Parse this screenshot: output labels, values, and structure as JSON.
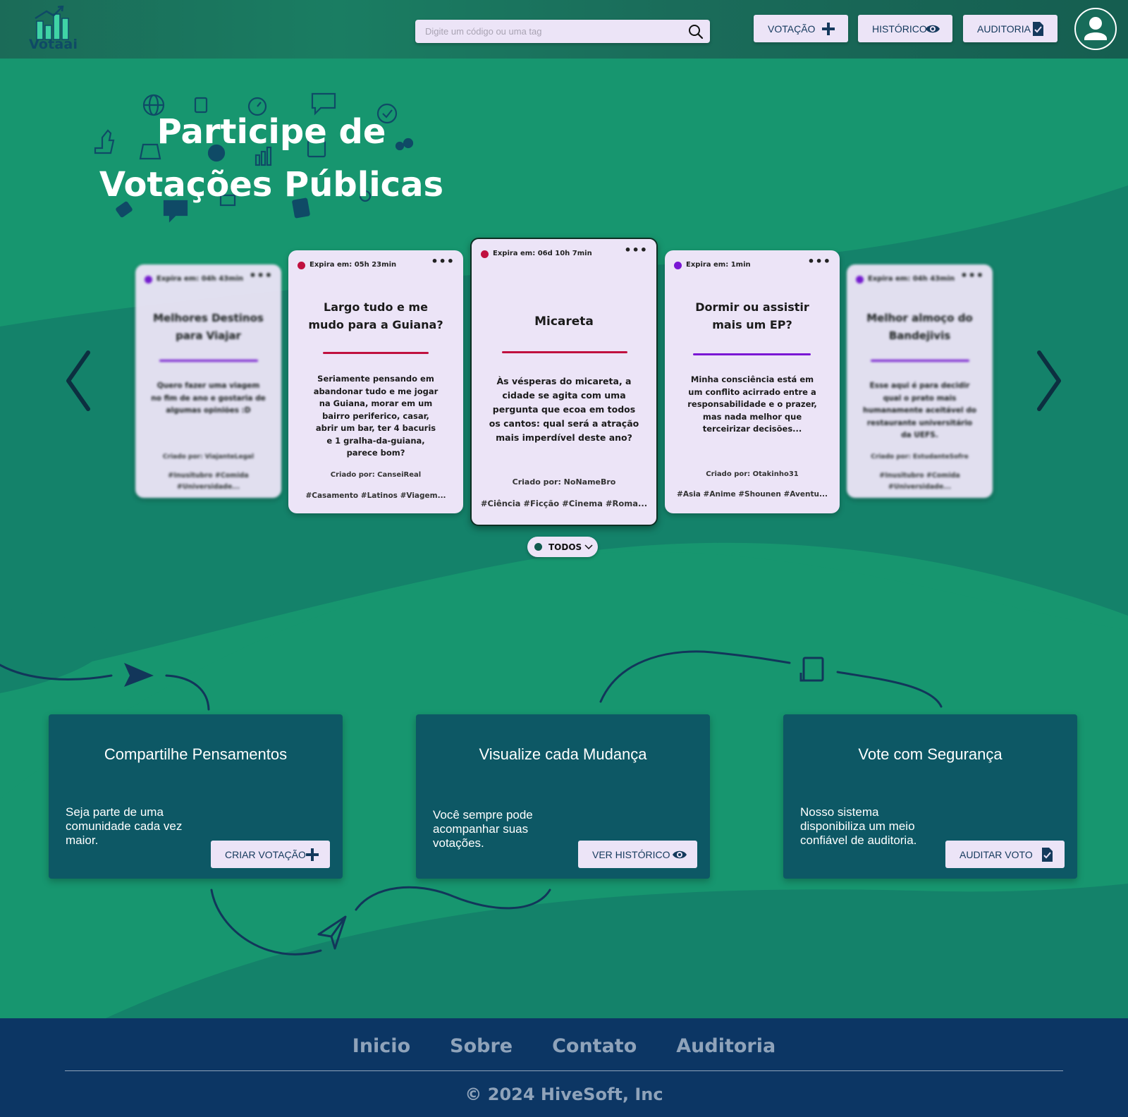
{
  "header": {
    "logo_text": "Votaai",
    "search_placeholder": "Digite um código ou uma tag",
    "buttons": [
      {
        "label": "VOTAÇÃO",
        "icon": "plus-icon"
      },
      {
        "label": "HISTÓRICO",
        "icon": "eye-icon"
      },
      {
        "label": "AUDITORIA",
        "icon": "document-check-icon"
      }
    ]
  },
  "hero": {
    "title_line1": "Participe de",
    "title_line2": "Votações Públicas"
  },
  "cards": [
    {
      "expire": "Expira em: 04h 43min",
      "title": "Melhores Destinos para Viajar",
      "description": "Quero fazer uma viagem no fim de ano e gostaria de algumas opiniões :D",
      "creator": "Criado por: ViajanteLegal",
      "tags": "#Inusitubro #Comida #Universidade...",
      "accent": "#7a16d4"
    },
    {
      "expire": "Expira em: 05h 23min",
      "title": "Largo tudo e me mudo para a Guiana?",
      "description": "Seriamente pensando em abandonar tudo e me jogar na Guiana, morar em um bairro periferico, casar, abrir um bar, ter 4 bacuris e 1 gralha-da-guiana, parece bom?",
      "creator": "Criado por: CanseiReal",
      "tags": "#Casamento #Latinos #Viagem...",
      "accent": "#c0103f"
    },
    {
      "expire": "Expira em: 06d 10h 7min",
      "title": "Micareta",
      "description": "Às vésperas do micareta, a cidade se agita com uma pergunta que ecoa em todos os cantos: qual será a atração mais imperdível deste ano?",
      "creator": "Criado por: NoNameBro",
      "tags": "#Ciência #Ficção #Cinema #Roma...",
      "accent": "#c0103f"
    },
    {
      "expire": "Expira em: 1min",
      "title": "Dormir ou assistir mais um EP?",
      "description": "Minha consciência está em um conflito acirrado entre a responsabilidade e o prazer, mas nada melhor que terceirizar decisões...",
      "creator": "Criado por: Otakinho31",
      "tags": "#Asia #Anime #Shounen #Aventu...",
      "accent": "#7a16d4"
    },
    {
      "expire": "Expira em: 04h 43min",
      "title": "Melhor almoço do Bandejivis",
      "description": "Esse aqui é para decidir qual o prato mais humanamente aceitável do restaurante universitário da UEFS.",
      "creator": "Criado por: EstudanteSofre",
      "tags": "#Inusitubro #Comida #Universidade...",
      "accent": "#7a16d4"
    }
  ],
  "filter": {
    "label": "TODOS"
  },
  "features": [
    {
      "title": "Compartilhe Pensamentos",
      "description": "Seja parte de uma comunidade cada vez maior.",
      "button": "CRIAR VOTAÇÃO",
      "icon": "plus-icon"
    },
    {
      "title": "Visualize cada Mudança",
      "description": "Você sempre pode acompanhar suas votações.",
      "button": "VER HISTÓRICO",
      "icon": "eye-icon"
    },
    {
      "title": "Vote com Segurança",
      "description": "Nosso sistema disponibiliza um meio confiável de auditoria.",
      "button": "AUDITAR VOTO",
      "icon": "document-check-icon"
    }
  ],
  "footer": {
    "links": [
      "Inicio",
      "Sobre",
      "Contato",
      "Auditoria"
    ],
    "copyright": "© 2024 HiveSoft, Inc"
  },
  "colors": {
    "primary_green": "#17966f",
    "dark_teal": "#0d5865",
    "footer_navy": "#0c3664",
    "card_bg": "#ece4f7",
    "accent_purple": "#7a16d4",
    "accent_red": "#c0103f"
  }
}
